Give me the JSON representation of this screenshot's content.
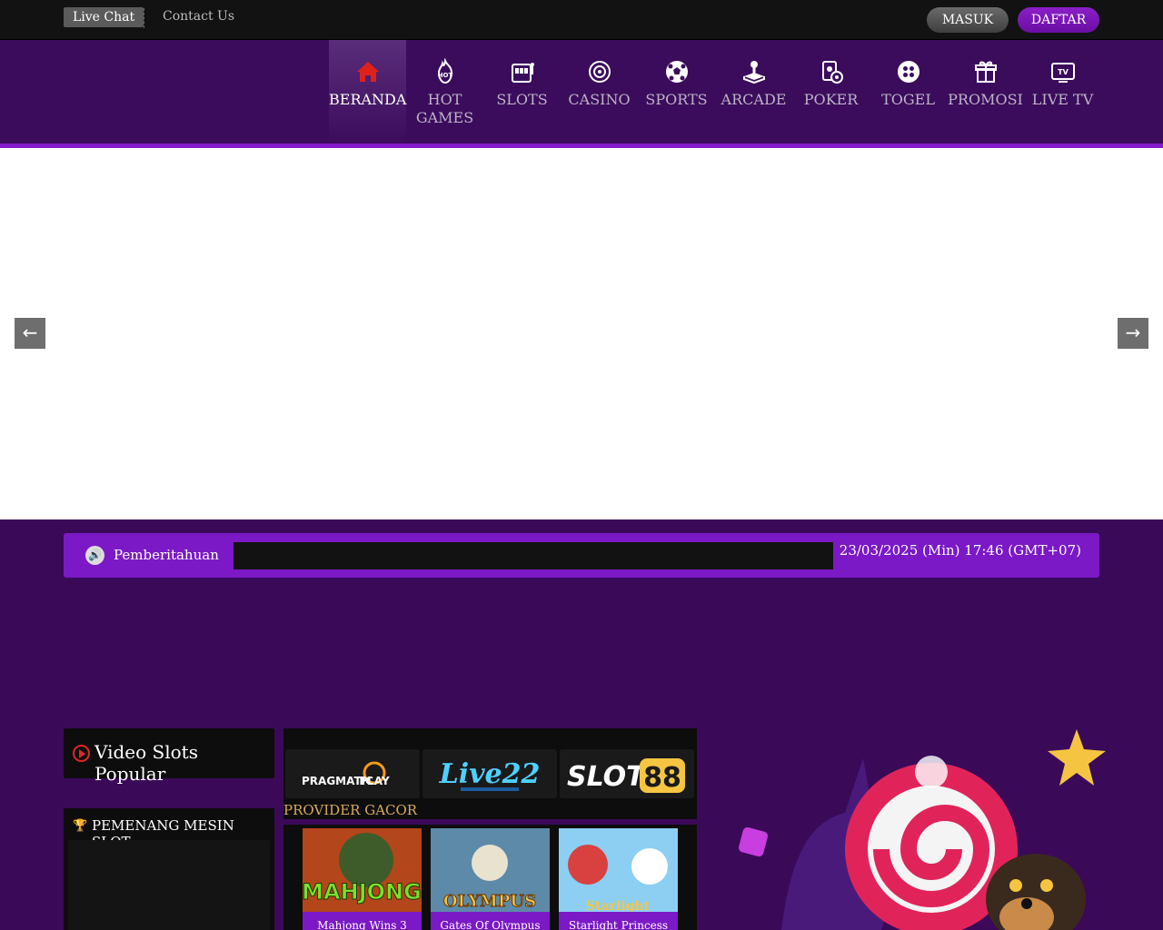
{
  "topbar": {
    "live_chat": "Live Chat",
    "contact_us": "Contact Us",
    "login": "MASUK",
    "register": "DAFTAR"
  },
  "nav": {
    "items": [
      {
        "label": "BERANDA",
        "icon": "home-icon",
        "active": true
      },
      {
        "label": "HOT GAMES",
        "icon": "hot-flame-icon"
      },
      {
        "label": "SLOTS",
        "icon": "slot-machine-icon"
      },
      {
        "label": "CASINO",
        "icon": "roulette-icon"
      },
      {
        "label": "SPORTS",
        "icon": "soccer-ball-icon"
      },
      {
        "label": "ARCADE",
        "icon": "joystick-icon"
      },
      {
        "label": "POKER",
        "icon": "poker-card-icon"
      },
      {
        "label": "TOGEL",
        "icon": "lottery-ball-icon"
      },
      {
        "label": "PROMOSI",
        "icon": "gift-icon"
      },
      {
        "label": "LIVE TV",
        "icon": "tv-icon"
      }
    ]
  },
  "banner": {
    "prev": "←",
    "next": "→"
  },
  "notice": {
    "icon": "speaker-icon",
    "label": "Pemberitahuan",
    "datetime": "23/03/2025 (Min) 17:46 (GMT+07)"
  },
  "video_slots": {
    "title": "Video Slots Popular"
  },
  "winners": {
    "title": "PEMENANG MESIN SLOT",
    "trophy": "🏆"
  },
  "providers": {
    "title": "PROVIDER GACOR",
    "logos": [
      {
        "name": "PRAGMATIC PLAY",
        "part1": "PRAGMATIC",
        "part2": "PLAY"
      },
      {
        "name": "Live22",
        "text": "Live22"
      },
      {
        "name": "SLOT88",
        "part1": "SLOT",
        "part2": "88"
      }
    ]
  },
  "games": [
    {
      "name": "Mahjong Wins 3",
      "art": "MAHJONG"
    },
    {
      "name": "Gates Of Olympus",
      "art": "OLYMPUS"
    },
    {
      "name": "Starlight Princess",
      "art": "Starlight"
    }
  ],
  "colors": {
    "primary_purple": "#7b19c6",
    "nav_bg": "#3b0c5c",
    "page_bg": "#3a0a59",
    "accent_gold": "#d9a95c"
  }
}
